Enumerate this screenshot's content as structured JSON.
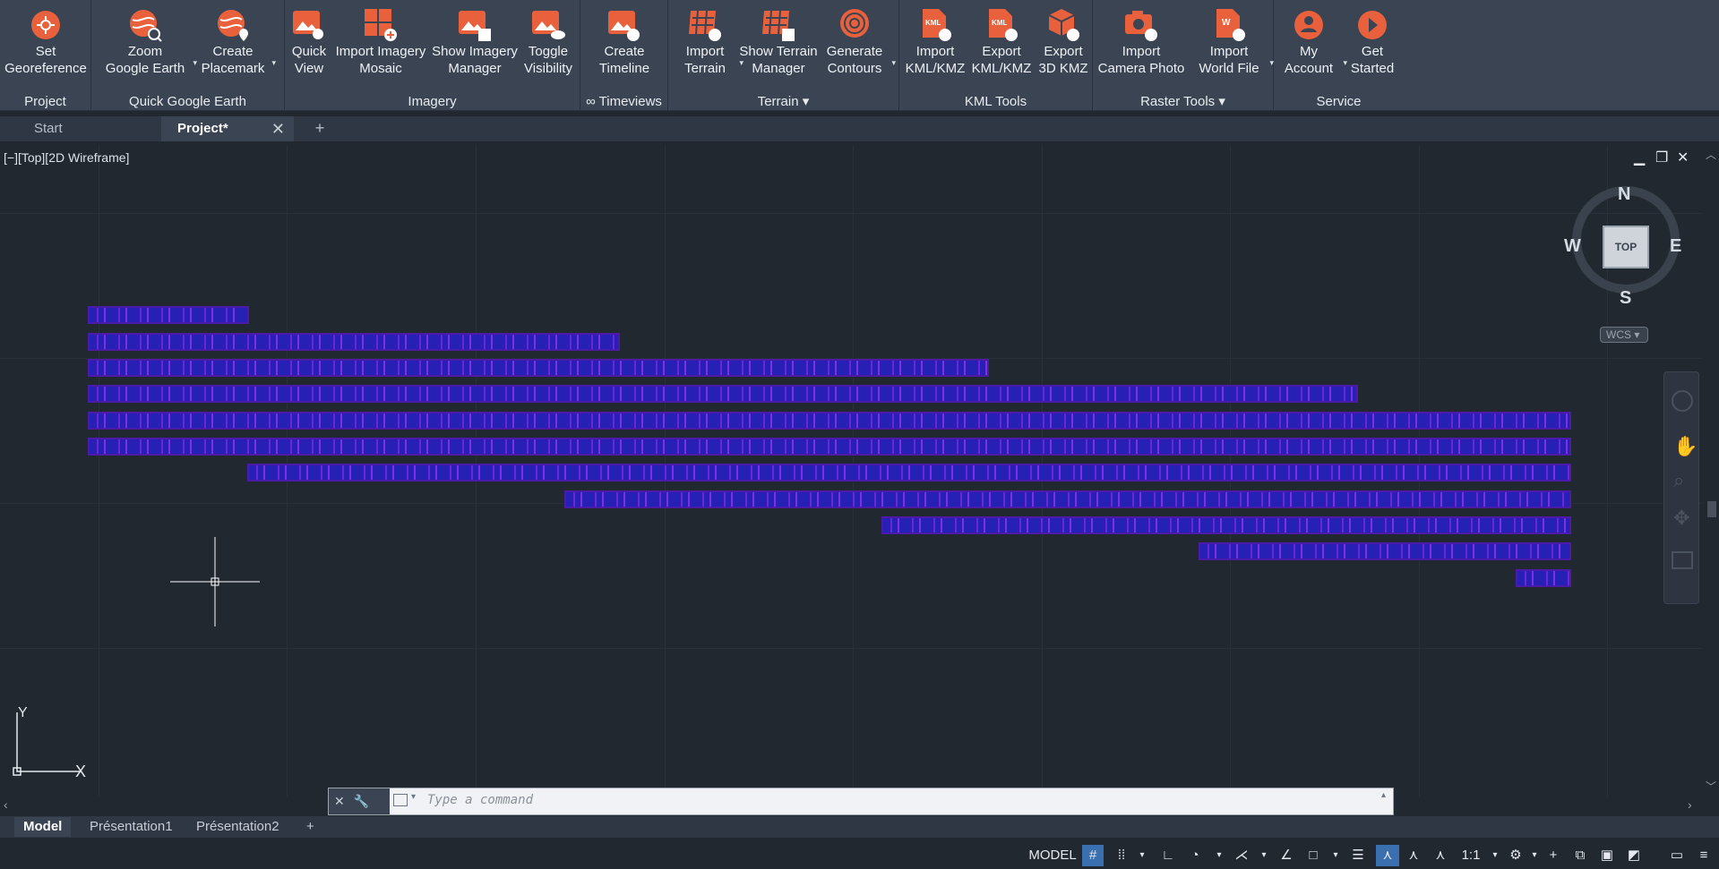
{
  "ribbon": {
    "panels": [
      {
        "title": "Project",
        "buttons": [
          {
            "label": "Set\nGeoreference",
            "l1": "Set",
            "l2": "Georeference"
          }
        ]
      },
      {
        "title": "Quick Google Earth",
        "buttons": [
          {
            "l1": "Zoom",
            "l2": "Google Earth"
          },
          {
            "l1": "Create",
            "l2": "Placemark"
          }
        ]
      },
      {
        "title": "Imagery",
        "buttons": [
          {
            "l1": "Quick",
            "l2": "View"
          },
          {
            "l1": "Import Imagery",
            "l2": "Mosaic"
          },
          {
            "l1": "Show Imagery",
            "l2": "Manager"
          },
          {
            "l1": "Toggle",
            "l2": "Visibility"
          }
        ]
      },
      {
        "title": "∞ Timeviews",
        "buttons": [
          {
            "l1": "Create",
            "l2": "Timeline"
          }
        ]
      },
      {
        "title": "Terrain",
        "buttons": [
          {
            "l1": "Import",
            "l2": "Terrain"
          },
          {
            "l1": "Show Terrain",
            "l2": "Manager"
          },
          {
            "l1": "Generate",
            "l2": "Contours"
          }
        ]
      },
      {
        "title": "KML Tools",
        "buttons": [
          {
            "l1": "Import",
            "l2": "KML/KMZ"
          },
          {
            "l1": "Export",
            "l2": "KML/KMZ"
          },
          {
            "l1": "Export",
            "l2": "3D KMZ"
          }
        ]
      },
      {
        "title": "Raster Tools",
        "buttons": [
          {
            "l1": "Import",
            "l2": "Camera Photo"
          },
          {
            "l1": "Import",
            "l2": "World File"
          }
        ]
      },
      {
        "title": "Service",
        "buttons": [
          {
            "l1": "My",
            "l2": "Account"
          },
          {
            "l1": "Get",
            "l2": "Started"
          }
        ]
      }
    ],
    "accent": "#e8603c"
  },
  "doc_tabs": {
    "start": "Start",
    "project": "Project*",
    "close": "✕",
    "add": "+"
  },
  "viewport": {
    "label": "[−][Top][2D Wireframe]",
    "compass": {
      "n": "N",
      "s": "S",
      "e": "E",
      "w": "W",
      "top": "TOP"
    },
    "wcs": "WCS ▾",
    "ucs_y": "Y",
    "ucs_x": "X"
  },
  "command": {
    "placeholder": "Type a command"
  },
  "layout_tabs": {
    "model": "Model",
    "p1": "Présentation1",
    "p2": "Présentation2",
    "add": "+"
  },
  "status": {
    "model": "MODEL",
    "scale": "1:1"
  }
}
